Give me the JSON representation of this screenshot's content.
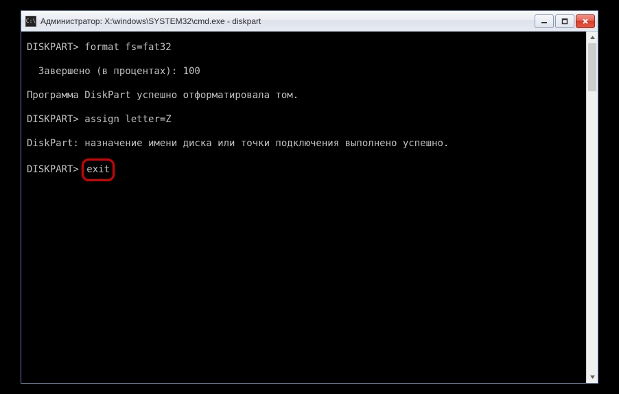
{
  "window": {
    "title": "Администратор: X:\\windows\\SYSTEM32\\cmd.exe - diskpart",
    "app_icon_text": "C:\\"
  },
  "terminal": {
    "prompt": "DISKPART>",
    "lines": [
      {
        "prompt": true,
        "text": "format fs=fat32"
      },
      {
        "prompt": false,
        "text": "  Завершено (в процентах): 100"
      },
      {
        "prompt": false,
        "text": "Программа DiskPart успешно отформатировала том."
      },
      {
        "prompt": true,
        "text": "assign letter=Z"
      },
      {
        "prompt": false,
        "text": "DiskPart: назначение имени диска или точки подключения выполнено успешно."
      },
      {
        "prompt": true,
        "text": "exit",
        "highlighted": true
      }
    ]
  },
  "controls": {
    "minimize": "Minimize",
    "maximize": "Maximize",
    "close": "Close"
  }
}
